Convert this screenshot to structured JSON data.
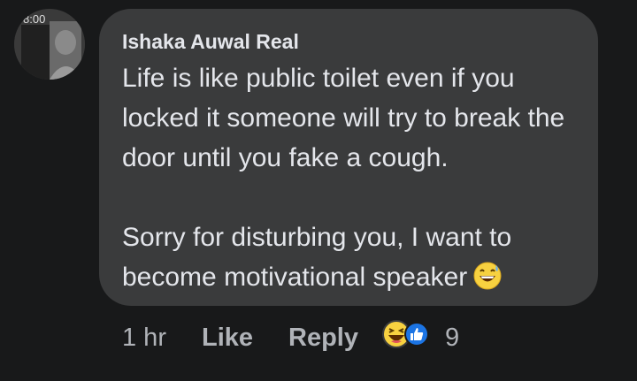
{
  "comment": {
    "author": "Ishaka Auwal Real",
    "avatar_overlay_time": "8:00",
    "paragraphs": [
      "Life is like public toilet even if you locked it someone will try to break the door until you fake a cough.",
      "Sorry for disturbing you,  I want to become motivational speaker"
    ],
    "trailing_emoji": "grinning-sweat-emoji"
  },
  "actions": {
    "time": "1 hr",
    "like_label": "Like",
    "reply_label": "Reply",
    "reactions": [
      "haha-reaction-icon",
      "like-reaction-icon"
    ],
    "reaction_count": "9"
  },
  "colors": {
    "background": "#18191a",
    "bubble": "#3a3b3c",
    "text": "#e4e6eb",
    "muted": "#b0b3b8",
    "like_blue": "#1b74e4",
    "haha_yellow": "#f7d140"
  }
}
